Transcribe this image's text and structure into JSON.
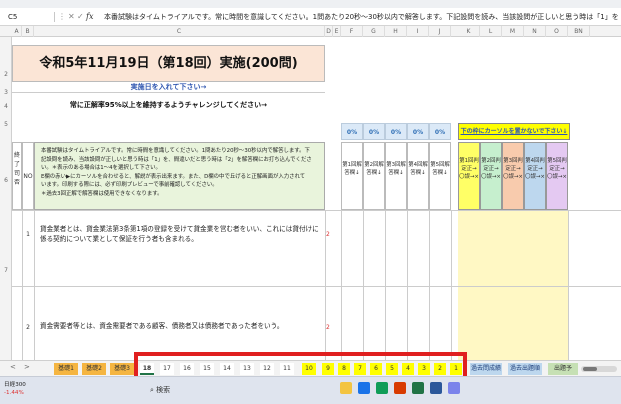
{
  "formula_bar": {
    "name_box": "C5",
    "dots": "⋮",
    "cancel": "✕",
    "confirm": "✓",
    "fx": "fx",
    "content": "本番試験はタイムトライアルです。常に時間を意識してください。1問あたり20秒〜30秒以内で解答します。下記設問を読み、当該設問が正しいと思う時は「1」を、他に行う"
  },
  "columns": [
    "A",
    "B",
    "C",
    "D",
    "E",
    "F",
    "G",
    "H",
    "I",
    "J",
    "K",
    "L",
    "M",
    "N",
    "O",
    "BN"
  ],
  "rows": [
    "1",
    "2",
    "3",
    "4",
    "5",
    "6",
    "7"
  ],
  "sheet": {
    "title": "令和5年11月19日（第18回）実施(200問)",
    "input_prompt": "実施日を入れて下さい→",
    "challenge": "常に正解率95%以上を維持するようチャレンジしてください→",
    "percentages": [
      "0%",
      "0%",
      "0%",
      "0%",
      "0%"
    ],
    "notice": "下の枠にカーソルを置かないで下さい↓",
    "left_header": "終了司否",
    "no_header": "NO",
    "instructions": [
      "本番試験はタイムトライアルです。常に時間を意識してください。1問あたり20秒〜30秒以内で解答します。下",
      "記設問を読み、当該設問が正しいと思う時は「1」を、間違いだと思う時は「2」を解答欄にお打ち込んでくださ",
      "い。＊表示のある場合は1〜4を選択して下さい。",
      "E欄の赤い▶にカーソルを合わせると、解説が表示出来ます。また、D欄の中で丘げると正解画面が入力されて",
      "います。印刷する際には、必ず印刷プレビューで事前確認してください。",
      "＊過去3回正解で解答欄は使用できなくなります。"
    ],
    "answer_headers": [
      "第1回解答欄↓",
      "第2回解答欄↓",
      "第3回解答欄↓",
      "第4回解答欄↓",
      "第5回解答欄↓"
    ],
    "result_headers": [
      "第1回判定正→〇誤→×",
      "第2回判定正→〇誤→×",
      "第3回判定正→〇誤→×",
      "第4回判定正→〇誤→×",
      "第5回判定正→〇誤→×"
    ],
    "questions": [
      {
        "no": "1",
        "text": "貸金業者とは、貸金業法第3条第1項の登録を受けて貸金業を営む者をいい、これには貸付けに係る契約について業として保証を行う者も含まれる。",
        "ref": "2"
      },
      {
        "no": "2",
        "text": "資金需要者等とは、資金需要者である顧客、債務者又は債務者であった者をいう。",
        "ref": "2"
      }
    ]
  },
  "tabs": {
    "prev": "<",
    "next": ">",
    "left_tabs": [
      "基礎1",
      "基礎2",
      "基礎3"
    ],
    "numbered": [
      "18",
      "17",
      "16",
      "15",
      "14",
      "13",
      "12",
      "11",
      "10",
      "9",
      "8",
      "7",
      "6",
      "5",
      "4",
      "3",
      "2",
      "1"
    ],
    "right_tabs": [
      "過去問成績",
      "過去出題順",
      "出題予"
    ]
  },
  "taskbar": {
    "stock_name": "日経300",
    "stock_change": "-1.44%",
    "search": "検索"
  },
  "colors": {
    "title_bg": "#fbe5d6",
    "instruction_bg": "#e9f4dc",
    "highlight_border": "#e02020",
    "tab_yellow": "#ffff00",
    "tab_orange": "#f5b541"
  }
}
